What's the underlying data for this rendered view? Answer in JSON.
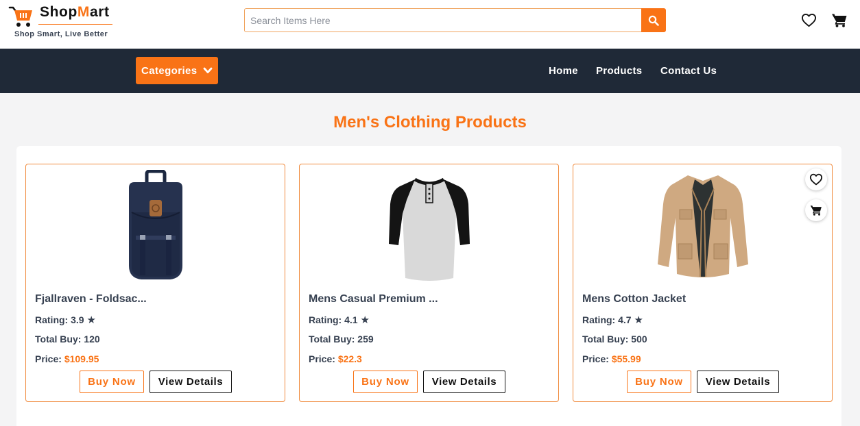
{
  "brand": {
    "name_part1": "Shop",
    "name_accent": "M",
    "name_part2": "art",
    "tagline": "Shop Smart, Live Better",
    "accent_color": "#f97316"
  },
  "search": {
    "placeholder": "Search Items Here",
    "value": ""
  },
  "header_icons": [
    "heart-icon",
    "cart-icon",
    "search-icon"
  ],
  "nav": {
    "categories_label": "Categories",
    "links": [
      "Home",
      "Products",
      "Contact Us"
    ]
  },
  "page": {
    "title": "Men's Clothing Products"
  },
  "products": [
    {
      "name": "Fjallraven - Foldsac...",
      "rating_label": "Rating:",
      "rating": "3.9",
      "total_label": "Total Buy:",
      "total": "120",
      "price_label": "Price:",
      "price": "$109.95",
      "buy_label": "Buy Now",
      "details_label": "View Details",
      "image": "backpack"
    },
    {
      "name": "Mens Casual Premium ...",
      "rating_label": "Rating:",
      "rating": "4.1",
      "total_label": "Total Buy:",
      "total": "259",
      "price_label": "Price:",
      "price": "$22.3",
      "buy_label": "Buy Now",
      "details_label": "View Details",
      "image": "raglan-tshirt"
    },
    {
      "name": "Mens Cotton Jacket",
      "rating_label": "Rating:",
      "rating": "4.7",
      "total_label": "Total Buy:",
      "total": "500",
      "price_label": "Price:",
      "price": "$55.99",
      "buy_label": "Buy Now",
      "details_label": "View Details",
      "image": "cotton-jacket"
    }
  ],
  "colors": {
    "navbar": "#1f2937",
    "accent": "#f97316",
    "background": "#f4f4f5"
  }
}
